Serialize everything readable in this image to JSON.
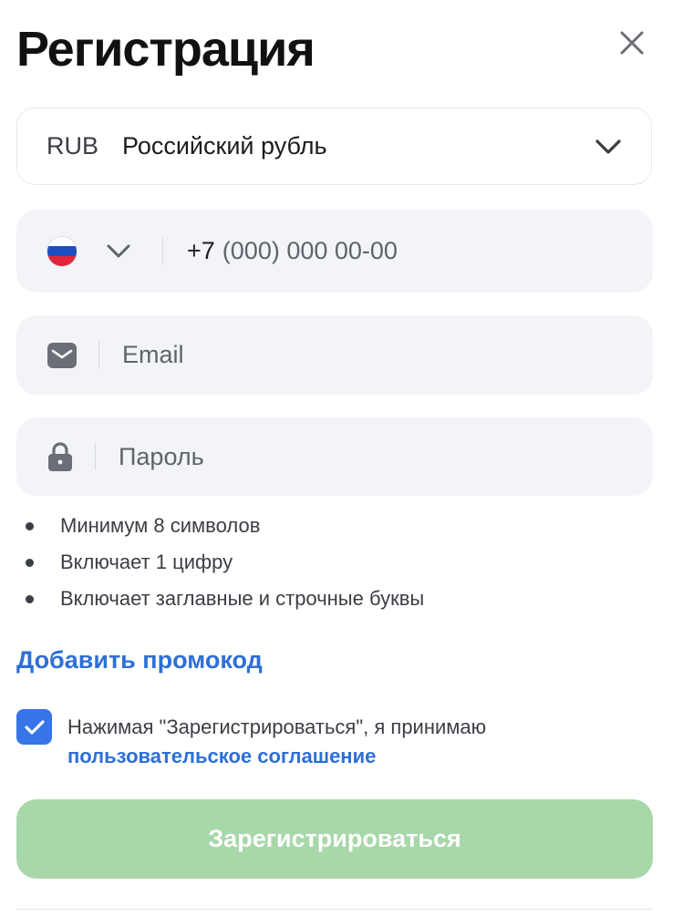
{
  "header": {
    "title": "Регистрация",
    "close_icon": "close-icon"
  },
  "currency": {
    "code": "RUB",
    "name": "Российский рубль",
    "icon": "chevron-down-icon"
  },
  "phone": {
    "country_flag": "flag-ru-icon",
    "flag_colors": [
      "#ffffff",
      "#1f4fbf",
      "#e0263a"
    ],
    "prefix": "+7",
    "placeholder": "(000) 000 00-00"
  },
  "email": {
    "icon": "envelope-icon",
    "placeholder": "Email"
  },
  "password": {
    "icon": "lock-icon",
    "placeholder": "Пароль"
  },
  "password_rules": [
    "Минимум 8 символов",
    "Включает 1 цифру",
    "Включает заглавные и строчные буквы"
  ],
  "promo": {
    "label": "Добавить промокод"
  },
  "agreement": {
    "checked": true,
    "text": "Нажимая \"Зарегистрироваться\", я принимаю",
    "link": "пользовательское соглашение"
  },
  "submit": {
    "label": "Зарегистрироваться"
  },
  "colors": {
    "accent": "#2d6fd6",
    "checkbox": "#3575e6",
    "submit_disabled": "#a8d7aa",
    "field_bg": "#f3f4f7"
  }
}
